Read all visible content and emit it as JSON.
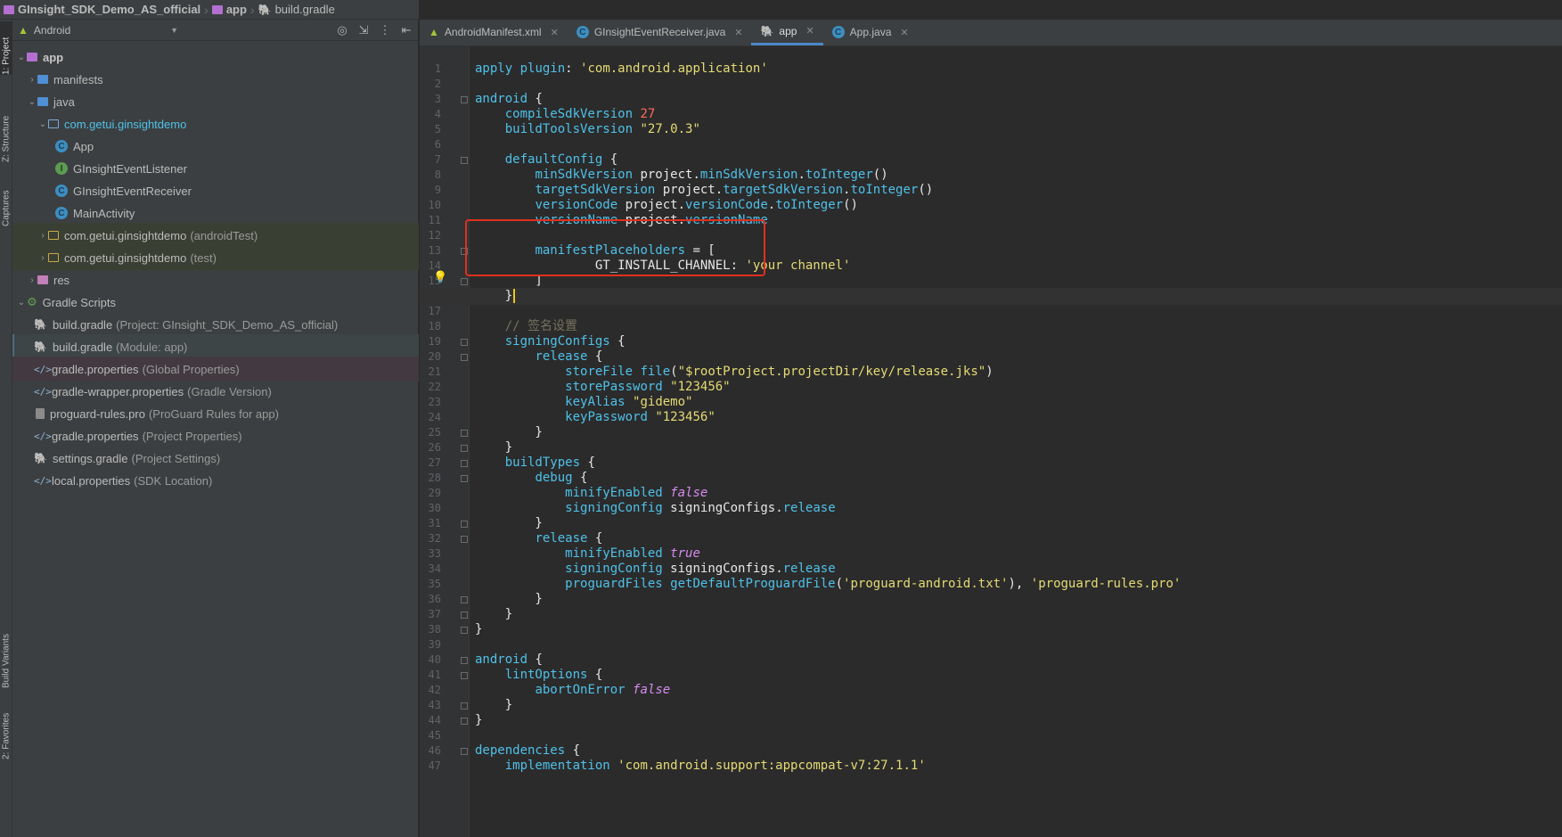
{
  "breadcrumb": [
    {
      "label": "GInsight_SDK_Demo_AS_official",
      "icon": "folder-icon"
    },
    {
      "label": "app",
      "icon": "folder-icon"
    },
    {
      "label": "build.gradle",
      "icon": "gradle-icon"
    }
  ],
  "left_stripe": {
    "project_tab": "1: Project",
    "structure_tab": "Z: Structure",
    "captures_tab": "Captures",
    "build_variants_tab": "Build Variants",
    "favorites_tab": "2: Favorites"
  },
  "project_panel": {
    "view_mode": "Android",
    "tree": [
      {
        "label": "app",
        "suffix": "",
        "level": 0,
        "arrow": "down"
      },
      {
        "label": "manifests",
        "suffix": "",
        "level": 1,
        "arrow": "right"
      },
      {
        "label": "java",
        "suffix": "",
        "level": 1,
        "arrow": "down"
      },
      {
        "label": "com.getui.ginsightdemo",
        "suffix": "",
        "level": 2,
        "arrow": "down"
      },
      {
        "label": "App",
        "suffix": "",
        "level": 3,
        "arrow": ""
      },
      {
        "label": "GInsightEventListener",
        "suffix": "",
        "level": 3,
        "arrow": ""
      },
      {
        "label": "GInsightEventReceiver",
        "suffix": "",
        "level": 3,
        "arrow": ""
      },
      {
        "label": "MainActivity",
        "suffix": "",
        "level": 3,
        "arrow": ""
      },
      {
        "label": "com.getui.ginsightdemo",
        "suffix": "(androidTest)",
        "level": 2,
        "arrow": "right"
      },
      {
        "label": "com.getui.ginsightdemo",
        "suffix": "(test)",
        "level": 2,
        "arrow": "right"
      },
      {
        "label": "res",
        "suffix": "",
        "level": 1,
        "arrow": "right"
      },
      {
        "label": "Gradle Scripts",
        "suffix": "",
        "level": 0,
        "arrow": "down"
      },
      {
        "label": "build.gradle",
        "suffix": "(Project: GInsight_SDK_Demo_AS_official)",
        "level": 1,
        "arrow": ""
      },
      {
        "label": "build.gradle",
        "suffix": "(Module: app)",
        "level": 1,
        "arrow": ""
      },
      {
        "label": "gradle.properties",
        "suffix": "(Global Properties)",
        "level": 1,
        "arrow": ""
      },
      {
        "label": "gradle-wrapper.properties",
        "suffix": "(Gradle Version)",
        "level": 1,
        "arrow": ""
      },
      {
        "label": "proguard-rules.pro",
        "suffix": "(ProGuard Rules for app)",
        "level": 1,
        "arrow": ""
      },
      {
        "label": "gradle.properties",
        "suffix": "(Project Properties)",
        "level": 1,
        "arrow": ""
      },
      {
        "label": "settings.gradle",
        "suffix": "(Project Settings)",
        "level": 1,
        "arrow": ""
      },
      {
        "label": "local.properties",
        "suffix": "(SDK Location)",
        "level": 1,
        "arrow": ""
      }
    ]
  },
  "editor": {
    "tabs": [
      {
        "label": "AndroidManifest.xml",
        "icon": "android-icon",
        "active": false
      },
      {
        "label": "GInsightEventReceiver.java",
        "icon": "class-icon",
        "active": false
      },
      {
        "label": "app",
        "icon": "gradle-icon",
        "active": true
      },
      {
        "label": "App.java",
        "icon": "class-icon",
        "active": false
      }
    ],
    "current_line": 16,
    "lines": [
      "apply plugin: 'com.android.application'",
      "",
      "android {",
      "    compileSdkVersion 27",
      "    buildToolsVersion \"27.0.3\"",
      "",
      "    defaultConfig {",
      "        minSdkVersion project.minSdkVersion.toInteger()",
      "        targetSdkVersion project.targetSdkVersion.toInteger()",
      "        versionCode project.versionCode.toInteger()",
      "        versionName project.versionName",
      "",
      "        manifestPlaceholders = [",
      "                GT_INSTALL_CHANNEL: 'your channel'",
      "        ]",
      "    }",
      "",
      "    // 签名设置",
      "    signingConfigs {",
      "        release {",
      "            storeFile file(\"$rootProject.projectDir/key/release.jks\")",
      "            storePassword \"123456\"",
      "            keyAlias \"gidemo\"",
      "            keyPassword \"123456\"",
      "        }",
      "    }",
      "    buildTypes {",
      "        debug {",
      "            minifyEnabled false",
      "            signingConfig signingConfigs.release",
      "        }",
      "        release {",
      "            minifyEnabled true",
      "            signingConfig signingConfigs.release",
      "            proguardFiles getDefaultProguardFile('proguard-android.txt'), 'proguard-rules.pro'",
      "        }",
      "    }",
      "}",
      "",
      "android {",
      "    lintOptions {",
      "        abortOnError false",
      "    }",
      "}",
      "",
      "dependencies {",
      "    implementation 'com.android.support:appcompat-v7:27.1.1'"
    ]
  },
  "colors": {
    "panel_bg": "#3c3f41",
    "editor_bg": "#2b2b2b",
    "highlight_box": "#e0301e",
    "keyword_cyan": "#4fc1e9",
    "string_yellow": "#e6db74"
  }
}
